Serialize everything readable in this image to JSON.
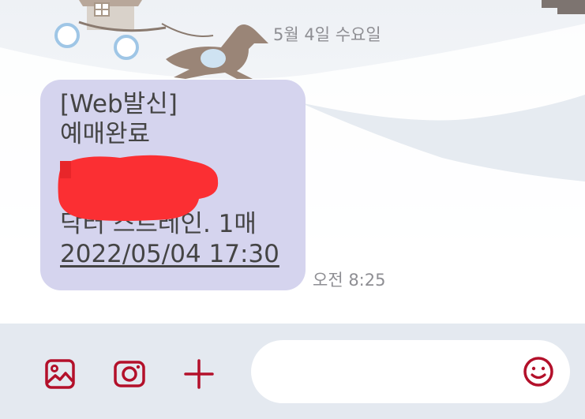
{
  "conversation": {
    "date_label": "5월 4일 수요일",
    "message": {
      "lines": [
        "[Web발신]",
        "예매완료",
        "닥터 스트레인. 1매"
      ],
      "datetime_link": "2022/05/04 17:30",
      "time": "오전 8:25"
    }
  },
  "composer": {
    "buttons": [
      "gallery-icon",
      "camera-icon",
      "plus-icon",
      "emoji-icon"
    ],
    "accent_color": "#b3102a"
  }
}
